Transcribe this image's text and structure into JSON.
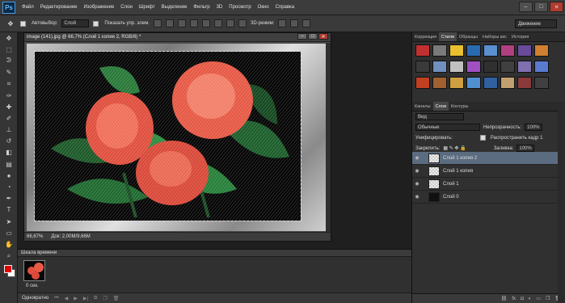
{
  "app": {
    "logo": "Ps"
  },
  "menu": [
    "Файл",
    "Редактирование",
    "Изображение",
    "Слои",
    "Шрифт",
    "Выделение",
    "Фильтр",
    "3D",
    "Просмотр",
    "Окно",
    "Справка"
  ],
  "window_buttons": {
    "minimize": "–",
    "restore": "□",
    "close": "✕"
  },
  "options": {
    "autoselect_label": "Автовыбор:",
    "autoselect_value": "Слой",
    "show_controls_label": "Показать упр. элем.",
    "mode_3d": "3D-режим:",
    "workspace_value": "Движение"
  },
  "tools": [
    {
      "icon": "move-tool-icon",
      "glyph": "✥"
    },
    {
      "icon": "marquee-tool-icon",
      "glyph": "⬚"
    },
    {
      "icon": "lasso-tool-icon",
      "glyph": "ᕲ"
    },
    {
      "icon": "quick-select-icon",
      "glyph": "✎"
    },
    {
      "icon": "crop-tool-icon",
      "glyph": "⌗"
    },
    {
      "icon": "eyedropper-icon",
      "glyph": "✑"
    },
    {
      "icon": "healing-brush-icon",
      "glyph": "✚"
    },
    {
      "icon": "brush-tool-icon",
      "glyph": "✐"
    },
    {
      "icon": "clone-stamp-icon",
      "glyph": "⊥"
    },
    {
      "icon": "history-brush-icon",
      "glyph": "↺"
    },
    {
      "icon": "eraser-tool-icon",
      "glyph": "◧"
    },
    {
      "icon": "gradient-tool-icon",
      "glyph": "▤"
    },
    {
      "icon": "blur-tool-icon",
      "glyph": "●"
    },
    {
      "icon": "dodge-tool-icon",
      "glyph": "◔"
    },
    {
      "icon": "pen-tool-icon",
      "glyph": "✒"
    },
    {
      "icon": "type-tool-icon",
      "glyph": "T"
    },
    {
      "icon": "path-select-icon",
      "glyph": "➤"
    },
    {
      "icon": "shape-tool-icon",
      "glyph": "▭"
    },
    {
      "icon": "hand-tool-icon",
      "glyph": "✋"
    },
    {
      "icon": "zoom-tool-icon",
      "glyph": "⌕"
    },
    {
      "icon": "more-tools-icon",
      "glyph": "…"
    }
  ],
  "document": {
    "title": "image (141).jpg @ 66,7% (Слой 1 копия 2, RGB/8) *",
    "zoom": "66,67%",
    "doc_size": "Док: 2,00M/9,66M"
  },
  "timeline": {
    "title": "Шкала времени",
    "frame_time": "0 сек.",
    "loop": "Однократно"
  },
  "panels": {
    "top_tabs": [
      "Коррекция",
      "Стили",
      "Образцы",
      "Наборы кис",
      "История"
    ],
    "top_active": 1,
    "styles_colors": [
      "#c03030",
      "#7a7a7a",
      "#e8c030",
      "#2a6ab0",
      "#5a8fd0",
      "#b04080",
      "#6a4a9a",
      "#d08030",
      "#3a3a3a",
      "#7090c0",
      "#c0c0c0",
      "#a050c0",
      "#303030",
      "#404040",
      "#8070b0",
      "#5a7ad0",
      "#c04020",
      "#a06030",
      "#d0a040",
      "#5090d0",
      "#3060a0",
      "#c0a070",
      "#8a3a3a",
      "#404040"
    ],
    "layers_tabs": [
      "Каналы",
      "Слои",
      "Контуры"
    ],
    "layers_active": 1,
    "filter_value": "Вид",
    "blend_mode": "Обычные",
    "opacity_label": "Непрозрачность:",
    "opacity_value": "100%",
    "unify_label": "Унифицировать:",
    "propagate_label": "Распространить кадр 1",
    "lock_label": "Закрепить:",
    "fill_label": "Заливка:",
    "fill_value": "100%",
    "layers": [
      {
        "name": "Слой 1 копия 2",
        "selected": true,
        "thumb": "checker"
      },
      {
        "name": "Слой 1 копия",
        "selected": false,
        "thumb": "checker"
      },
      {
        "name": "Слой 1",
        "selected": false,
        "thumb": "checker"
      },
      {
        "name": "Слой 0",
        "selected": false,
        "thumb": "image"
      }
    ]
  }
}
